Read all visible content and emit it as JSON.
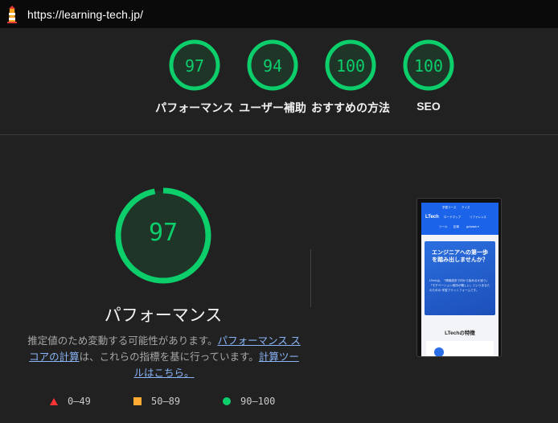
{
  "browser": {
    "url": "https://learning-tech.jp/"
  },
  "summary_scores": [
    {
      "score": "97",
      "label": "パフォーマンス"
    },
    {
      "score": "94",
      "label": "ユーザー補助"
    },
    {
      "score": "100",
      "label": "おすすめの方法"
    },
    {
      "score": "100",
      "label": "SEO"
    }
  ],
  "detail": {
    "score": "97",
    "title": "パフォーマンス",
    "desc_prefix": "推定値のため変動する可能性があります。",
    "link_score_calc": "パフォーマンス スコアの計算",
    "desc_middle": "は、これらの指標を基に行っています。",
    "link_calculator": "計算ツールはこちら。"
  },
  "legend": {
    "fail": "0–49",
    "average": "50–89",
    "pass": "90–100"
  },
  "screenshot_thumb": {
    "brand": "LTech",
    "nav_items": [
      "学習コース",
      "クイズ",
      "ロードマップ",
      "リファレンス",
      "ツール",
      "記事",
      "go/stack ▾"
    ],
    "hero_heading": "エンジニアへの第一歩を踏み出しませんか？",
    "hero_text": "LTechは、「情報過多で何から始めるか迷う」「モチベーション維持が難しい」というあなたのための 学習プラットフォームです。",
    "features_heading": "LTechの特徴"
  },
  "colors": {
    "pass": "#0cce6b",
    "average": "#ffaa33",
    "fail": "#ff3333",
    "link": "#8ab4f8",
    "background": "#212121"
  }
}
